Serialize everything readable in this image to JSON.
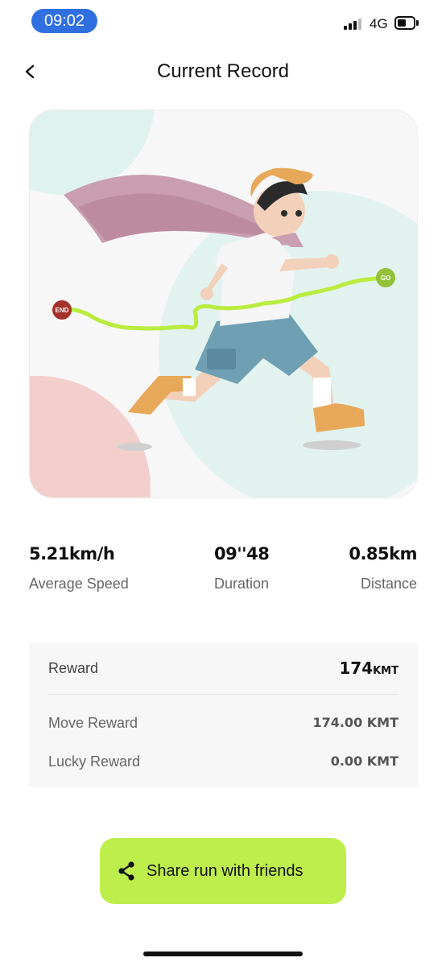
{
  "status_bar": {
    "time": "09:02",
    "network": "4G"
  },
  "header": {
    "title": "Current Record"
  },
  "hero": {
    "start_marker": "GO",
    "end_marker": "END"
  },
  "stats": [
    {
      "value": "5.21km/h",
      "label": "Average Speed"
    },
    {
      "value": "09''48",
      "label": "Duration"
    },
    {
      "value": "0.85km",
      "label": "Distance"
    }
  ],
  "reward": {
    "label": "Reward",
    "total_value": "174",
    "total_unit": "KMT",
    "rows": [
      {
        "label": "Move Reward",
        "value": "174.00 KMT"
      },
      {
        "label": "Lucky Reward",
        "value": "0.00 KMT"
      }
    ]
  },
  "share": {
    "label": "Share run with friends"
  },
  "colors": {
    "accent": "#bdee4b",
    "time_pill": "#2f6fe0",
    "route": "#b9ec3e",
    "end_marker": "#a4312a",
    "go_marker": "#94c13a"
  }
}
